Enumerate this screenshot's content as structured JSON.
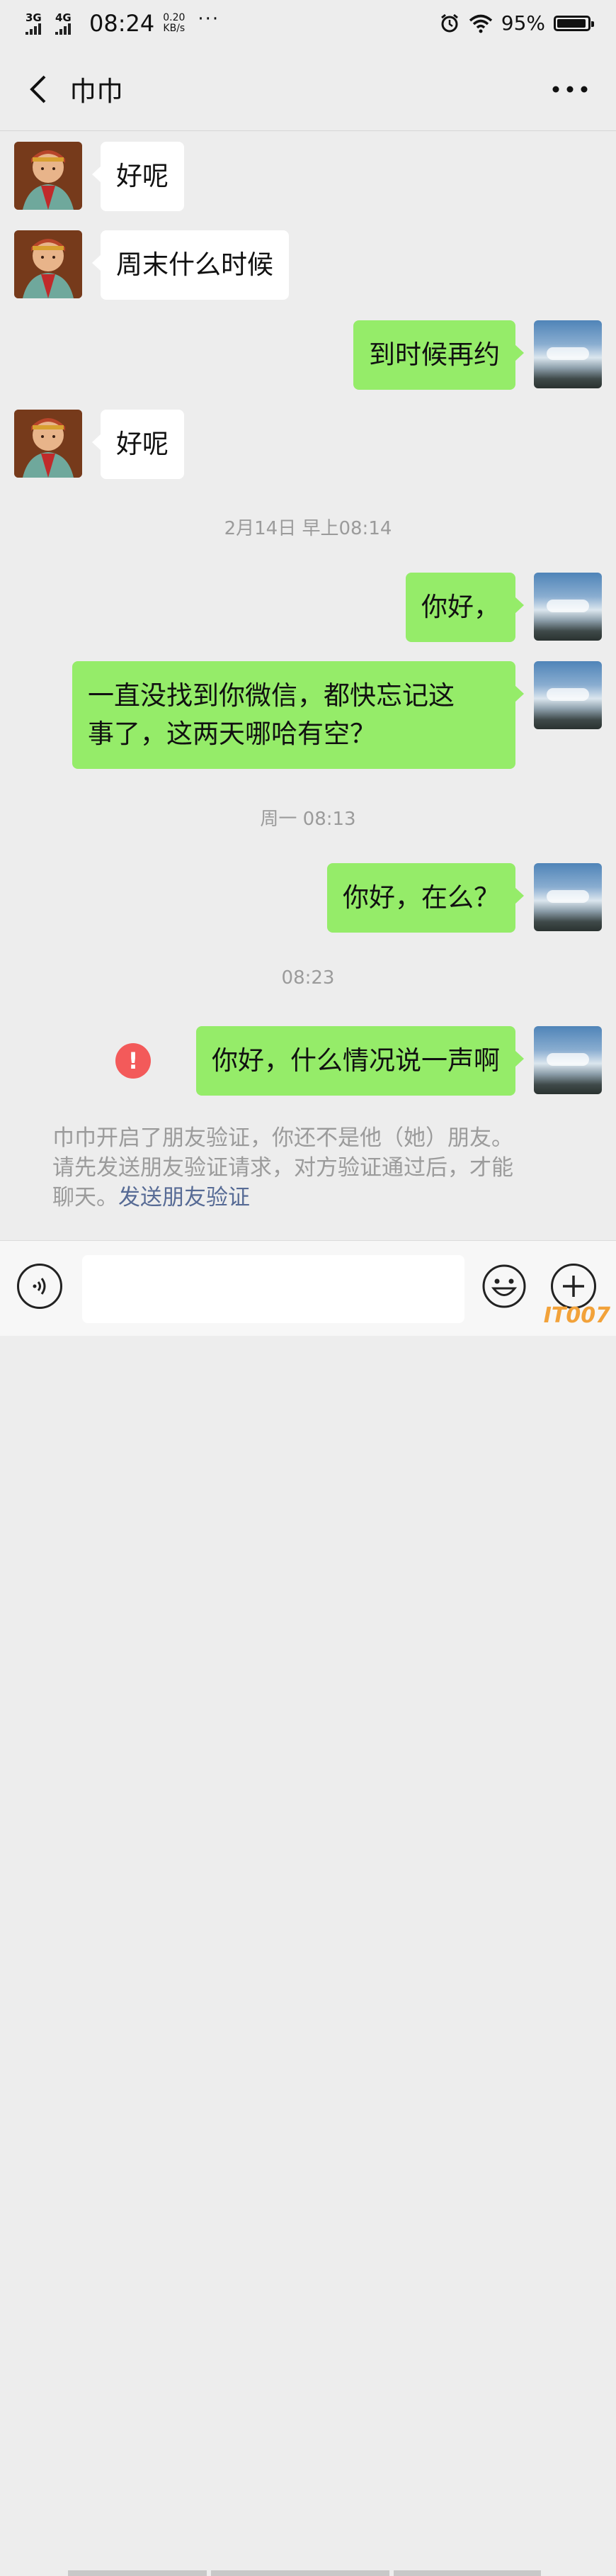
{
  "status_bar": {
    "network_1": "3G",
    "network_2": "4G",
    "time": "08:24",
    "speed_value": "0.20",
    "speed_unit": "KB/s",
    "more": "···",
    "battery_percent": "95%",
    "battery_level": 0.95
  },
  "header": {
    "title": "巾巾",
    "back_icon": "chevron-left-icon",
    "more_icon": "more-dots-icon"
  },
  "messages": [
    {
      "side": "in",
      "text": "好呢"
    },
    {
      "side": "in",
      "text": "周末什么时候"
    },
    {
      "side": "out",
      "text": "到时候再约"
    },
    {
      "side": "in",
      "text": "好呢"
    },
    {
      "type": "timestamp",
      "text": "2月14日 早上08:14"
    },
    {
      "side": "out",
      "text": "你好，"
    },
    {
      "side": "out",
      "text_line1": "一直没找到你微信，都快忘记这",
      "text_line2": "事了，这两天哪哈有空？"
    },
    {
      "type": "timestamp",
      "text": "周一 08:13"
    },
    {
      "side": "out",
      "text": "你好，在么？"
    },
    {
      "type": "timestamp",
      "text": "08:23"
    },
    {
      "side": "out",
      "text": "你好，什么情况说一声啊",
      "failed": true,
      "error_mark": "!"
    }
  ],
  "system_notice": {
    "line1": "巾巾开启了朋友验证，你还不是他（她）朋友。",
    "line2": "请先发送朋友验证请求，对方验证通过后，才能",
    "line3_prefix": "聊天。",
    "link": "发送朋友验证"
  },
  "input_bar": {
    "voice_icon": "voice-icon",
    "emoji_icon": "emoji-icon",
    "plus_icon": "plus-icon",
    "placeholder": ""
  },
  "watermark": "IT007",
  "colors": {
    "background": "#ededed",
    "bubble_out": "#95ec69",
    "bubble_in": "#ffffff",
    "error": "#f35a5a",
    "link": "#576b95",
    "timestamp": "#9b9b9b"
  }
}
